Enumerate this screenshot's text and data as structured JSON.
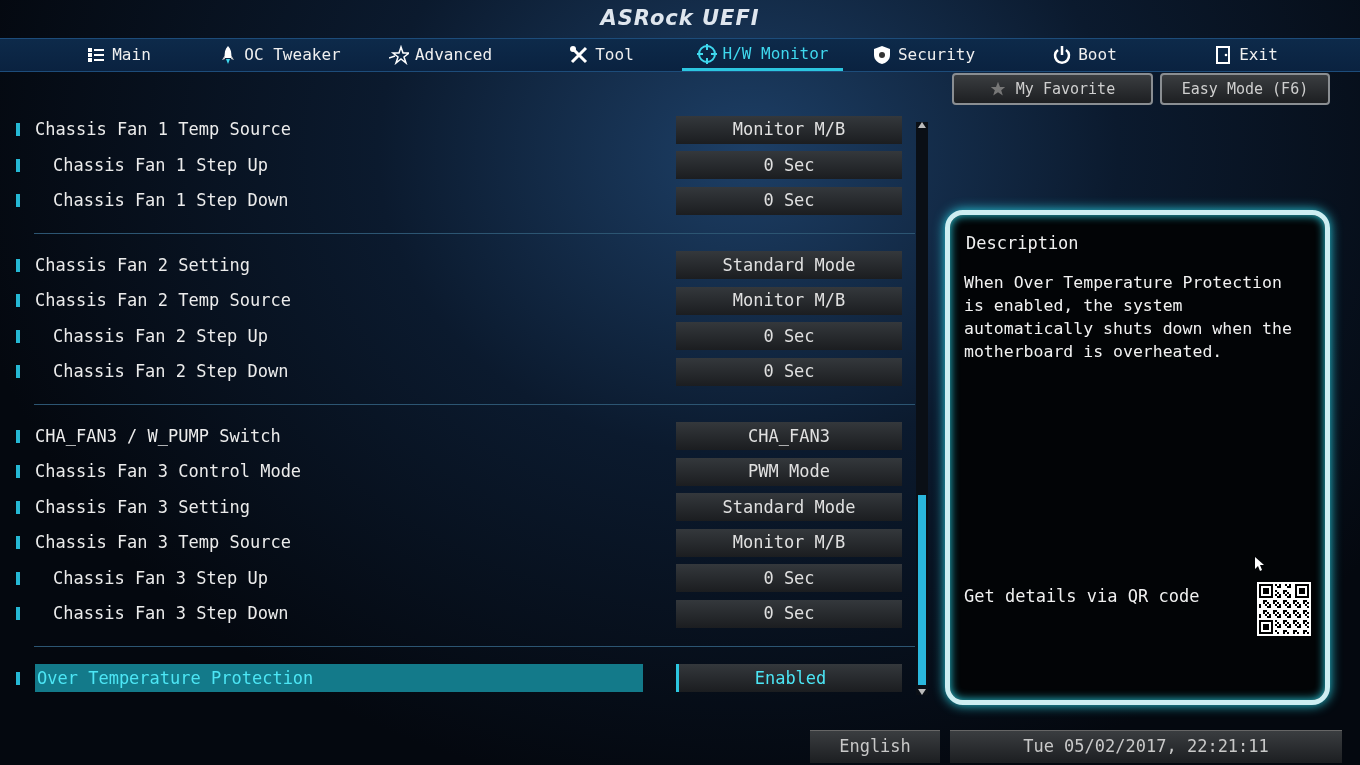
{
  "header": {
    "title": "ASRock UEFI"
  },
  "tabs": [
    {
      "label": "Main",
      "selected": false
    },
    {
      "label": "OC Tweaker",
      "selected": false
    },
    {
      "label": "Advanced",
      "selected": false
    },
    {
      "label": "Tool",
      "selected": false
    },
    {
      "label": "H/W Monitor",
      "selected": true
    },
    {
      "label": "Security",
      "selected": false
    },
    {
      "label": "Boot",
      "selected": false
    },
    {
      "label": "Exit",
      "selected": false
    }
  ],
  "quick_buttons": [
    {
      "label": "My Favorite"
    },
    {
      "label": "Easy Mode (F6)"
    }
  ],
  "settings_groups": [
    {
      "items": [
        {
          "label": "Chassis Fan 1 Temp Source",
          "value": "Monitor M/B",
          "selected": false,
          "children": [
            {
              "label": "Chassis Fan 1 Step Up",
              "value": "0 Sec",
              "selected": false
            },
            {
              "label": "Chassis Fan 1 Step Down",
              "value": "0 Sec",
              "selected": false
            }
          ]
        }
      ]
    },
    {
      "items": [
        {
          "label": "Chassis Fan 2 Setting",
          "value": "Standard Mode",
          "selected": false
        },
        {
          "label": "Chassis Fan 2 Temp Source",
          "value": "Monitor M/B",
          "selected": false,
          "children": [
            {
              "label": "Chassis Fan 2 Step Up",
              "value": "0 Sec",
              "selected": false
            },
            {
              "label": "Chassis Fan 2 Step Down",
              "value": "0 Sec",
              "selected": false
            }
          ]
        }
      ]
    },
    {
      "items": [
        {
          "label": "CHA_FAN3 / W_PUMP Switch",
          "value": "CHA_FAN3",
          "selected": false
        },
        {
          "label": "Chassis Fan 3 Control Mode",
          "value": "PWM Mode",
          "selected": false
        },
        {
          "label": "Chassis Fan 3 Setting",
          "value": "Standard Mode",
          "selected": false
        },
        {
          "label": "Chassis Fan 3 Temp Source",
          "value": "Monitor M/B",
          "selected": false,
          "children": [
            {
              "label": "Chassis Fan 3 Step Up",
              "value": "0 Sec",
              "selected": false
            },
            {
              "label": "Chassis Fan 3 Step Down",
              "value": "0 Sec",
              "selected": false
            }
          ]
        }
      ]
    },
    {
      "items": [
        {
          "label": "Over Temperature Protection",
          "value": "Enabled",
          "selected": true
        }
      ]
    }
  ],
  "description": {
    "title": "Description",
    "text": "When Over Temperature Protection is enabled, the system automatically shuts down when the motherboard is overheated.",
    "qr_caption": "Get details via QR code"
  },
  "status_bar": {
    "language": "English",
    "datetime": "Tue 05/02/2017, 22:21:11"
  }
}
